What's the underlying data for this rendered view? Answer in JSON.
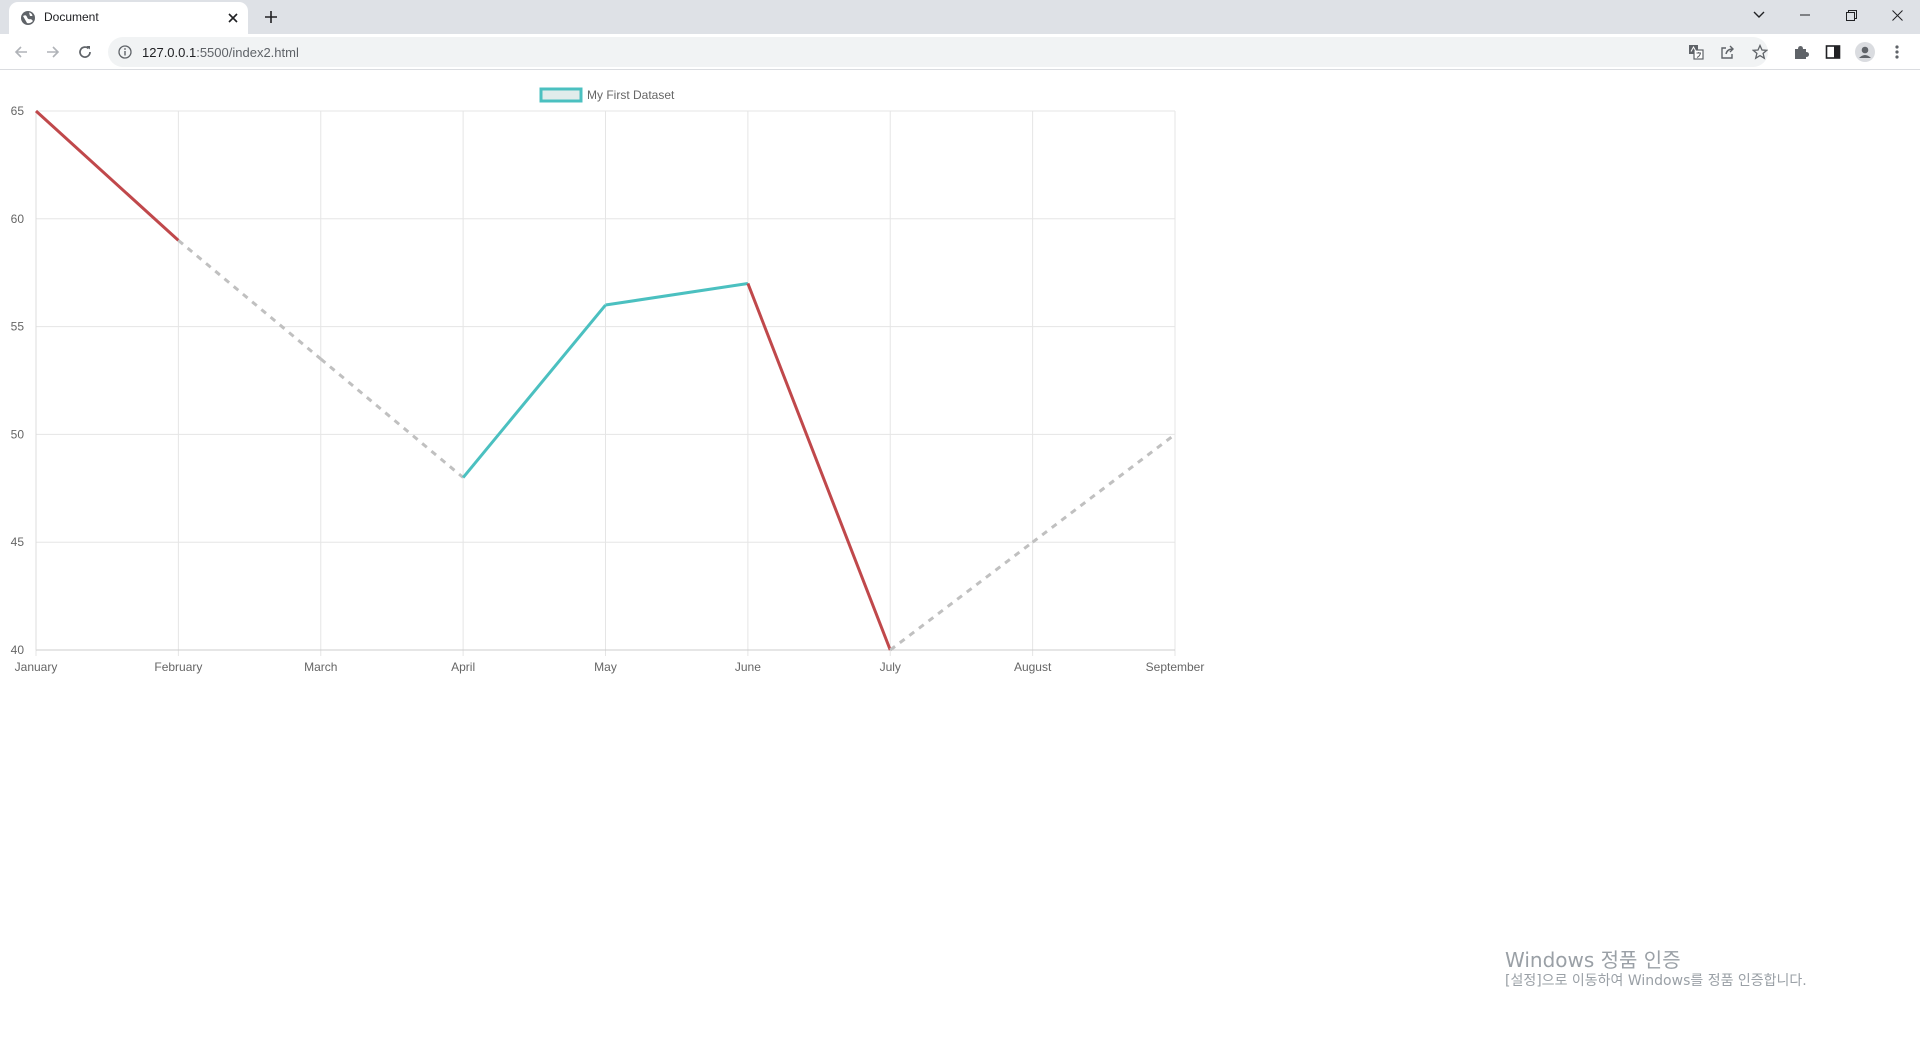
{
  "browser": {
    "tab_title": "Document",
    "url_host": "127.0.0.1",
    "url_path": ":5500/index2.html"
  },
  "colors": {
    "segment_up": "#4bc0c0",
    "segment_down": "#c0484b",
    "segment_skip": "#c0c0c0",
    "grid": "#e5e5e5",
    "legend_fill": "#e0eceb"
  },
  "chart_data": {
    "type": "line",
    "categories": [
      "January",
      "February",
      "March",
      "April",
      "May",
      "June",
      "July",
      "August",
      "September"
    ],
    "series": [
      {
        "name": "My First Dataset",
        "values": [
          65,
          59,
          null,
          48,
          56,
          57,
          40,
          null,
          50
        ]
      }
    ],
    "ylim": [
      40,
      65
    ],
    "yticks": [
      40,
      45,
      50,
      55,
      60,
      65
    ],
    "segment_styles": "rising segments teal, falling segments red, gaps across missing values dashed grey",
    "legend": "top",
    "grid": true
  },
  "watermark": {
    "title": "Windows 정품 인증",
    "subtitle": "[설정]으로 이동하여 Windows를 정품 인증합니다."
  }
}
